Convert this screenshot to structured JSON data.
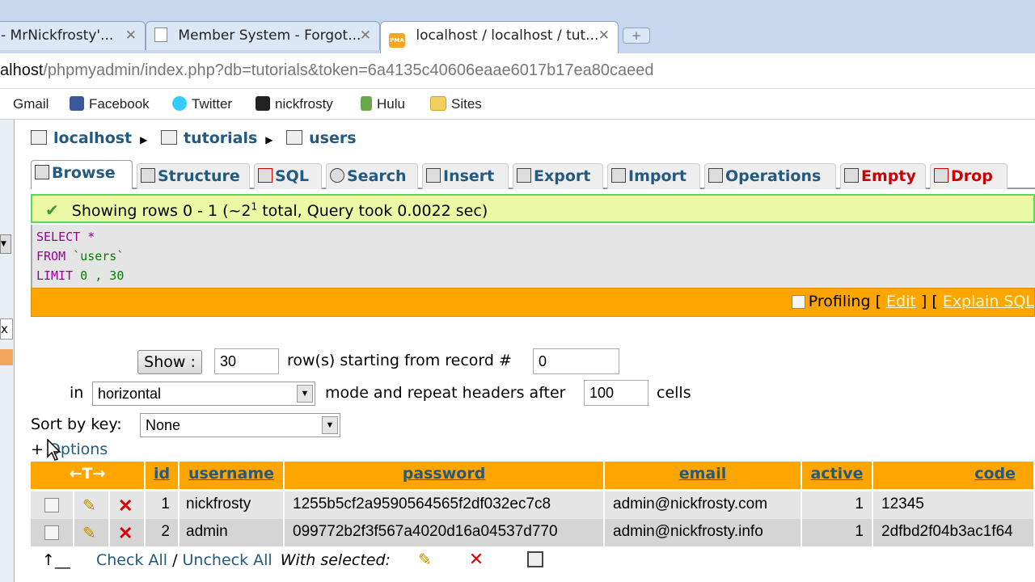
{
  "browser": {
    "tabs": [
      {
        "label": "- MrNickfrosty'...",
        "close": "✕"
      },
      {
        "label": "Member System - Forgot...",
        "close": "✕"
      },
      {
        "label": "localhost / localhost / tut...",
        "close": "✕",
        "favicon": "PMA"
      }
    ],
    "new_tab": "+",
    "url_host": "alhost",
    "url_path": "/phpmyadmin/index.php?db=tutorials&token=6a4135c40606eaae6017b17ea80caeed",
    "bookmarks": [
      "Gmail",
      "Facebook",
      "Twitter",
      "nickfrosty",
      "Hulu",
      "Sites"
    ]
  },
  "breadcrumb": {
    "server": "localhost",
    "database": "tutorials",
    "table": "users"
  },
  "pma_tabs": [
    "Browse",
    "Structure",
    "SQL",
    "Search",
    "Insert",
    "Export",
    "Import",
    "Operations",
    "Empty",
    "Drop"
  ],
  "notice": {
    "text_before": "Showing rows 0 - 1 (~2",
    "sup": "1",
    "text_after": " total, Query took 0.0022 sec)"
  },
  "sql": {
    "line1_kw": "SELECT",
    "line1_rest": " *",
    "line2_kw": "FROM",
    "line2_rest": " `users`",
    "line3_kw": "LIMIT",
    "line3_rest": " 0 , 30"
  },
  "sql_links": {
    "profiling": "Profiling",
    "edit": "Edit",
    "explain": "Explain SQL"
  },
  "nav": {
    "show_button": "Show :",
    "rows_value": "30",
    "rows_text": "row(s) starting from record #",
    "start_value": "0",
    "in_text": "in",
    "mode_value": "horizontal",
    "mode_text": "mode and repeat headers after",
    "headers_value": "100",
    "cells_text": "cells",
    "sort_label": "Sort by key:",
    "sort_value": "None"
  },
  "options_link": "Options",
  "table": {
    "arrows": "←T→",
    "columns": [
      "id",
      "username",
      "password",
      "email",
      "active",
      "code"
    ],
    "rows": [
      {
        "id": "1",
        "username": "nickfrosty",
        "password": "1255b5cf2a9590564565f2df032ec7c8",
        "email": "admin@nickfrosty.com",
        "active": "1",
        "code": "12345"
      },
      {
        "id": "2",
        "username": "admin",
        "password": "099772b2f3f567a4020d16a04537d770",
        "email": "admin@nickfrosty.info",
        "active": "1",
        "code": "2dfbd2f04b3ac1f64"
      }
    ]
  },
  "bulk": {
    "check_all": "Check All",
    "sep": "/",
    "uncheck_all": "Uncheck All",
    "with_selected": "With selected:"
  },
  "colors": {
    "accent": "#ffa500",
    "link": "#235a81",
    "notice_bg": "#ebf8a4",
    "notice_border": "#5bd95b",
    "danger": "#cc0000"
  }
}
